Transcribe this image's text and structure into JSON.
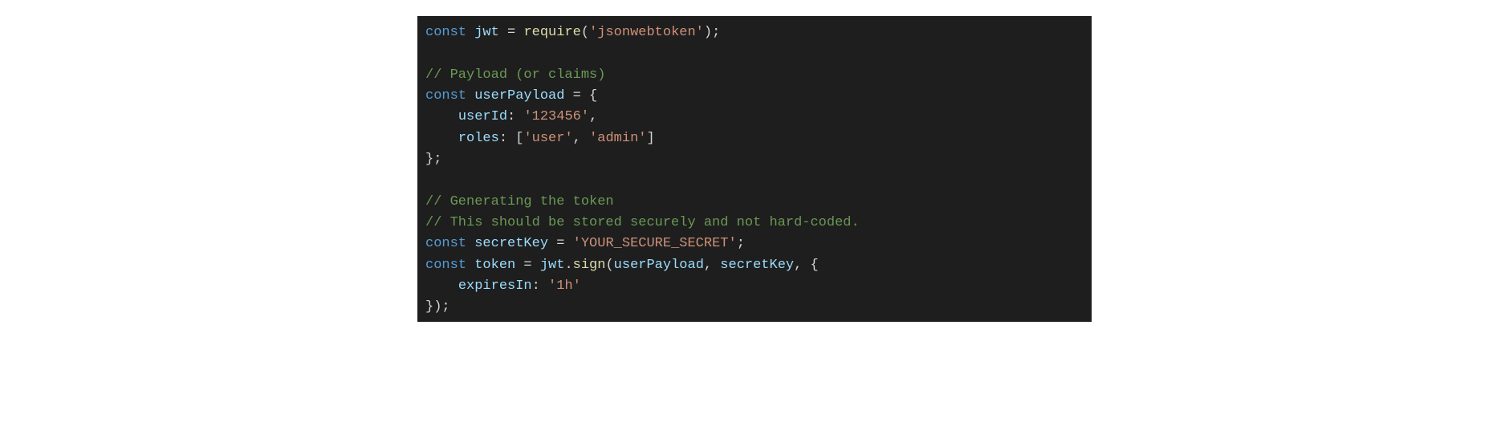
{
  "code": {
    "lines": [
      [
        {
          "t": "const",
          "c": "tok-keyword"
        },
        {
          "t": " ",
          "c": "tok-punct"
        },
        {
          "t": "jwt",
          "c": "tok-var"
        },
        {
          "t": " = ",
          "c": "tok-punct"
        },
        {
          "t": "require",
          "c": "tok-func"
        },
        {
          "t": "(",
          "c": "tok-punct"
        },
        {
          "t": "'jsonwebtoken'",
          "c": "tok-string"
        },
        {
          "t": ");",
          "c": "tok-punct"
        }
      ],
      [
        {
          "t": " ",
          "c": "tok-punct"
        }
      ],
      [
        {
          "t": "// Payload (or claims)",
          "c": "tok-comment"
        }
      ],
      [
        {
          "t": "const",
          "c": "tok-keyword"
        },
        {
          "t": " ",
          "c": "tok-punct"
        },
        {
          "t": "userPayload",
          "c": "tok-var"
        },
        {
          "t": " = {",
          "c": "tok-punct"
        }
      ],
      [
        {
          "t": "    ",
          "c": "tok-punct"
        },
        {
          "t": "userId",
          "c": "tok-prop"
        },
        {
          "t": ": ",
          "c": "tok-punct"
        },
        {
          "t": "'123456'",
          "c": "tok-string"
        },
        {
          "t": ",",
          "c": "tok-punct"
        }
      ],
      [
        {
          "t": "    ",
          "c": "tok-punct"
        },
        {
          "t": "roles",
          "c": "tok-prop"
        },
        {
          "t": ": [",
          "c": "tok-punct"
        },
        {
          "t": "'user'",
          "c": "tok-string"
        },
        {
          "t": ", ",
          "c": "tok-punct"
        },
        {
          "t": "'admin'",
          "c": "tok-string"
        },
        {
          "t": "]",
          "c": "tok-punct"
        }
      ],
      [
        {
          "t": "};",
          "c": "tok-punct"
        }
      ],
      [
        {
          "t": " ",
          "c": "tok-punct"
        }
      ],
      [
        {
          "t": "// Generating the token",
          "c": "tok-comment"
        }
      ],
      [
        {
          "t": "// This should be stored securely and not hard-coded.",
          "c": "tok-comment"
        }
      ],
      [
        {
          "t": "const",
          "c": "tok-keyword"
        },
        {
          "t": " ",
          "c": "tok-punct"
        },
        {
          "t": "secretKey",
          "c": "tok-var"
        },
        {
          "t": " = ",
          "c": "tok-punct"
        },
        {
          "t": "'YOUR_SECURE_SECRET'",
          "c": "tok-string"
        },
        {
          "t": ";",
          "c": "tok-punct"
        }
      ],
      [
        {
          "t": "const",
          "c": "tok-keyword"
        },
        {
          "t": " ",
          "c": "tok-punct"
        },
        {
          "t": "token",
          "c": "tok-var"
        },
        {
          "t": " = ",
          "c": "tok-punct"
        },
        {
          "t": "jwt",
          "c": "tok-var"
        },
        {
          "t": ".",
          "c": "tok-punct"
        },
        {
          "t": "sign",
          "c": "tok-func"
        },
        {
          "t": "(",
          "c": "tok-punct"
        },
        {
          "t": "userPayload",
          "c": "tok-var"
        },
        {
          "t": ", ",
          "c": "tok-punct"
        },
        {
          "t": "secretKey",
          "c": "tok-var"
        },
        {
          "t": ", {",
          "c": "tok-punct"
        }
      ],
      [
        {
          "t": "    ",
          "c": "tok-punct"
        },
        {
          "t": "expiresIn",
          "c": "tok-prop"
        },
        {
          "t": ": ",
          "c": "tok-punct"
        },
        {
          "t": "'1h'",
          "c": "tok-string"
        }
      ],
      [
        {
          "t": "});",
          "c": "tok-punct"
        }
      ]
    ]
  }
}
